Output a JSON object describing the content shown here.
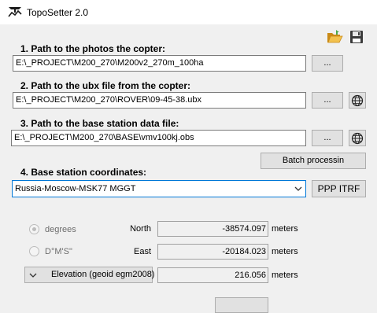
{
  "window": {
    "title": "TopoSetter 2.0",
    "app_icon": "toposetter-app-icon"
  },
  "toolbar": {
    "open_icon": "folder-open-icon",
    "save_icon": "floppy-disk-icon"
  },
  "photos": {
    "label": "1. Path to the photos the copter:",
    "path": "E:\\_PROJECT\\M200_270\\M200v2_270m_100ha",
    "browse_label": "..."
  },
  "ubx": {
    "label": "2. Path to the ubx file from the copter:",
    "path": "E:\\_PROJECT\\M200_270\\ROVER\\09-45-38.ubx",
    "browse_label": "...",
    "web_icon": "globe-icon"
  },
  "base": {
    "label": "3. Path to the base station data file:",
    "path": "E:\\_PROJECT\\M200_270\\BASE\\vmv100kj.obs",
    "browse_label": "...",
    "web_icon": "globe-icon",
    "batch_label": "Batch processin"
  },
  "coords": {
    "label": "4. Base station coordinates:",
    "system": "Russia-Moscow-MSK77 MGGT",
    "ppp_label": "PPP ITRF",
    "format_degrees": "degrees",
    "format_dms": "D°M'S\"",
    "format_selected": "degrees",
    "north_label": "North",
    "north_value": "-38574.097",
    "east_label": "East",
    "east_value": "-20184.023",
    "elevation_label": "Elevation (geoid egm2008)",
    "elevation_value": "216.056",
    "unit": "meters"
  },
  "colors": {
    "accent": "#0078d7",
    "folder": "#e8b23a",
    "globe": "#222222"
  }
}
